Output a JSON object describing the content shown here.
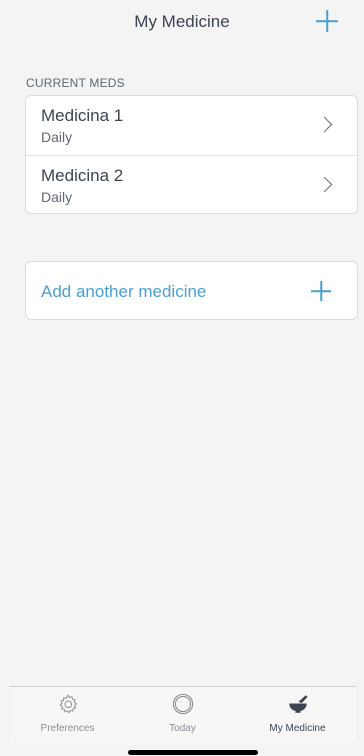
{
  "header": {
    "title": "My Medicine",
    "add_icon": "plus-icon"
  },
  "current_meds": {
    "section_label": "CURRENT MEDS",
    "items": [
      {
        "name": "Medicina 1",
        "frequency": "Daily"
      },
      {
        "name": "Medicina 2",
        "frequency": "Daily"
      }
    ]
  },
  "add_another": {
    "label": "Add another medicine",
    "icon": "plus-icon"
  },
  "tab_bar": {
    "tabs": [
      {
        "label": "Preferences",
        "icon": "gear-icon",
        "active": false
      },
      {
        "label": "Today",
        "icon": "ring-icon",
        "active": false
      },
      {
        "label": "My Medicine",
        "icon": "mortar-pestle-icon",
        "active": true
      }
    ]
  },
  "colors": {
    "accent": "#4a9fd2",
    "text_primary": "#3c4452",
    "background": "#f4f4f4"
  }
}
